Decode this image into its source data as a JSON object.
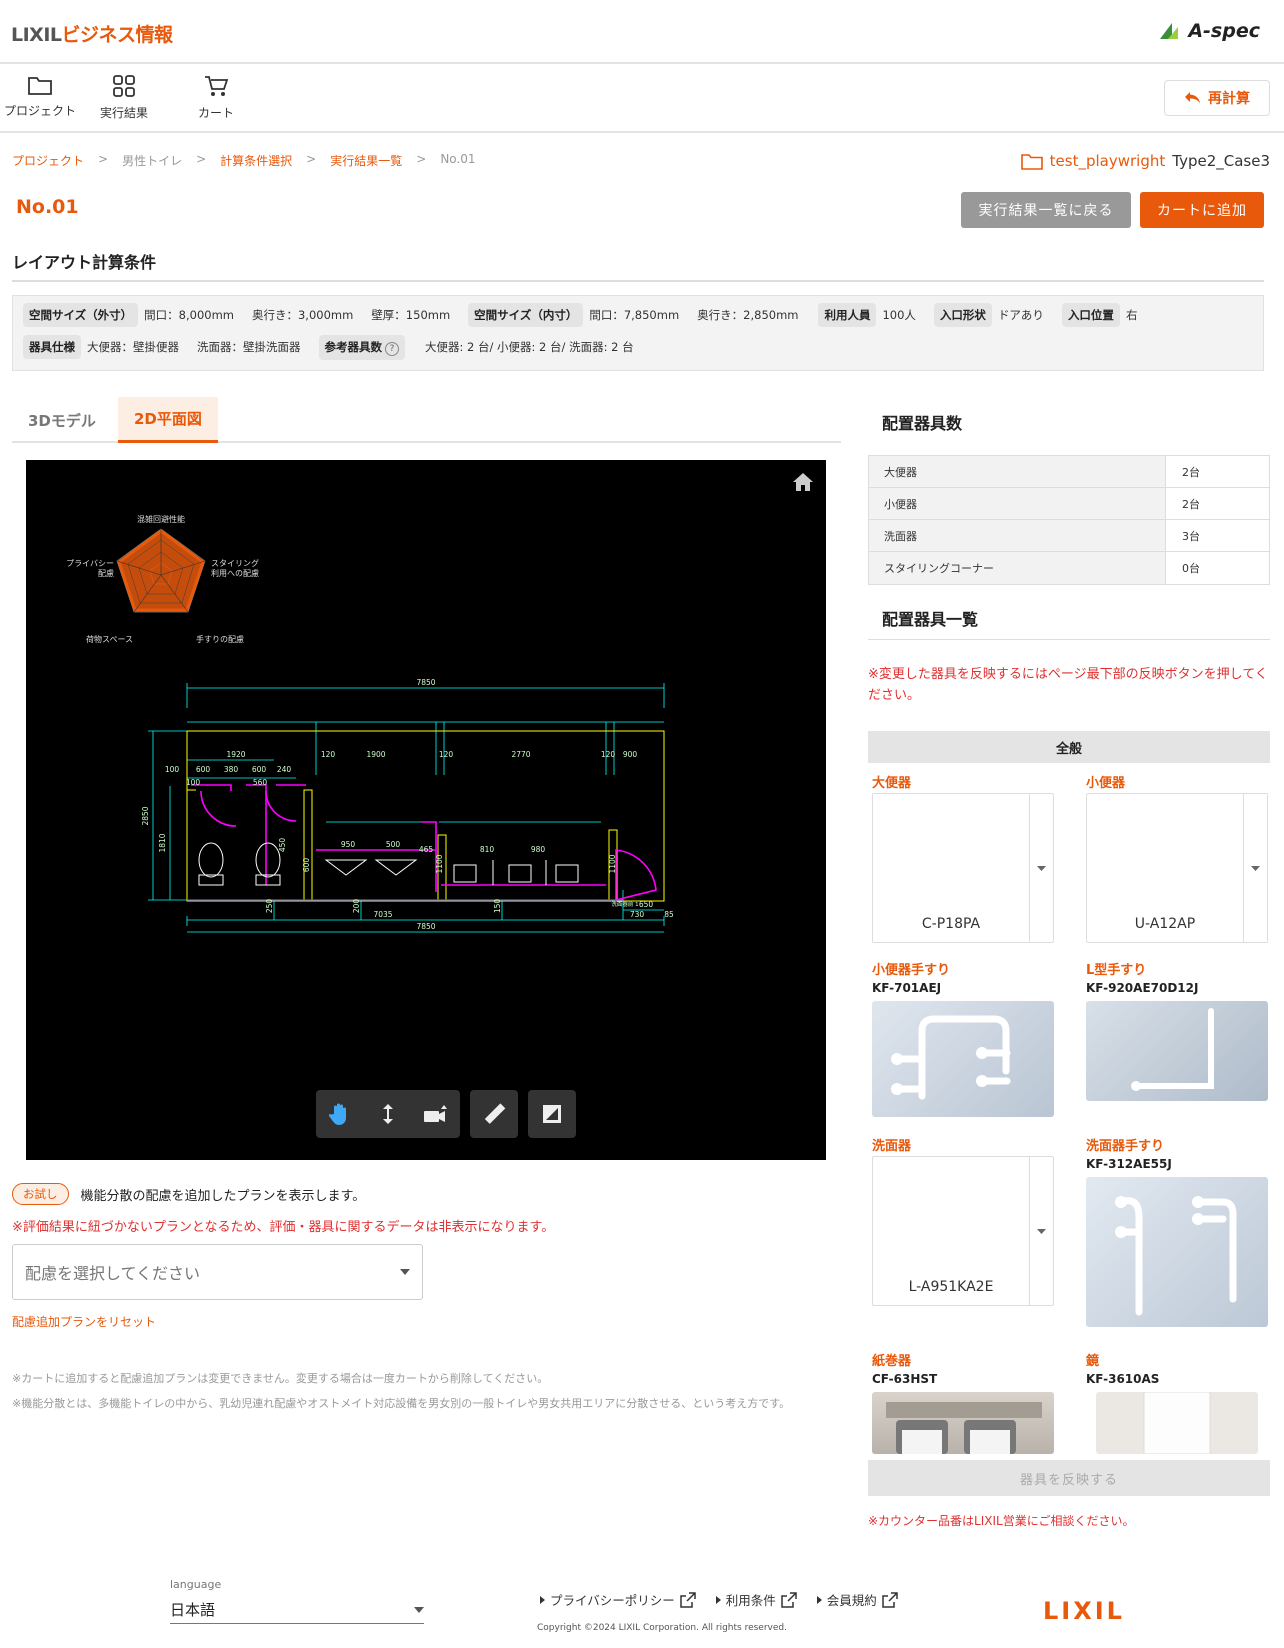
{
  "header": {
    "brand_main": "LIXIL",
    "brand_sub": "ビジネス情報",
    "aspec": "A-spec"
  },
  "toolbar": {
    "project": "プロジェクト",
    "results": "実行結果",
    "cart": "カート",
    "recalc": "再計算"
  },
  "breadcrumb": [
    "プロジェクト",
    ">",
    "男性トイレ",
    ">",
    "計算条件選択",
    ">",
    "実行結果一覧",
    ">",
    "No.01"
  ],
  "project": {
    "name": "test_playwright",
    "case": "Type2_Case3"
  },
  "page": {
    "title": "No.01",
    "back": "実行結果一覧に戻る",
    "add_cart": "カートに追加",
    "section": "レイアウト計算条件"
  },
  "conditions": {
    "outer_tag": "空間サイズ（外寸）",
    "outer_w": "間口：8,000mm",
    "outer_d": "奥行き：3,000mm",
    "wall": "壁厚：150mm",
    "inner_tag": "空間サイズ（内寸）",
    "inner_w": "間口：7,850mm",
    "inner_d": "奥行き：2,850mm",
    "users_tag": "利用人員",
    "users": "100人",
    "entry_tag": "入口形状",
    "entry": "ドアあり",
    "pos_tag": "入口位置",
    "pos": "右",
    "fix_tag": "器具仕様",
    "fix1": "大便器：壁掛便器",
    "fix2": "洗面器：壁掛洗面器",
    "ref_tag": "参考器具数",
    "q": "?",
    "ref": "大便器: 2 台/ 小便器: 2 台/ 洗面器: 2 台"
  },
  "tabs": {
    "t3d": "3Dモデル",
    "t2d": "2D平面図"
  },
  "radar": {
    "top": "混雑回避性能",
    "right1": "スタイリング",
    "right2": "利用への配慮",
    "br": "手すりの配慮",
    "bl": "荷物スペース",
    "left1": "プライバシー",
    "left2": "配慮"
  },
  "cad_dims": {
    "d7850": "7850",
    "d1920": "1920",
    "d120a": "120",
    "d1900": "1900",
    "d120b": "120",
    "d2770": "2770",
    "d120c": "120",
    "d900": "900",
    "d100": "100",
    "d600": "600",
    "d380": "380",
    "d600b": "600",
    "d240": "240",
    "d560": "560",
    "d100b": "100",
    "d2850": "2850",
    "d1810": "1810",
    "d950": "950",
    "d500": "500",
    "d465": "465",
    "d810": "810",
    "d980": "980",
    "d1100": "1100",
    "d1100b": "1100",
    "d600v": "600",
    "d450": "450",
    "d250": "250",
    "d200": "200",
    "d150": "150",
    "d7035": "7035",
    "d650": "650",
    "d730": "730",
    "d85": "85",
    "d7850b": "7850",
    "dlbl": "洗面器前 1"
  },
  "trial": {
    "badge": "お試し",
    "text": "機能分散の配慮を追加したプランを表示します。"
  },
  "warn": "※評価結果に紐づかないプランとなるため、評価・器具に関するデータは非表示になります。",
  "select": {
    "placeholder": "配慮を選択してください"
  },
  "reset": "配慮追加プランをリセット",
  "notes": {
    "n1": "※カートに追加すると配慮追加プランは変更できません。変更する場合は一度カートから削除してください。",
    "n2": "※機能分散とは、多機能トイレの中から、乳幼児連れ配慮やオストメイト対応設備を男女別の一般トイレや男女共用エリアに分散させる、という考え方です。"
  },
  "counts": {
    "title": "配置器具数",
    "rows": [
      [
        "大便器",
        "2台"
      ],
      [
        "小便器",
        "2台"
      ],
      [
        "洗面器",
        "3台"
      ],
      [
        "スタイリングコーナー",
        "0台"
      ]
    ]
  },
  "list": {
    "title": "配置器具一覧",
    "warn": "※変更した器具を反映するにはページ最下部の反映ボタンを押してください。",
    "general": "全般",
    "toilet": "大便器",
    "toilet_val": "C-P18PA",
    "urinal": "小便器",
    "urinal_val": "U-A12AP",
    "urinal_rail": "小便器手すり",
    "urinal_rail_code": "KF-701AEJ",
    "lrail": "L型手すり",
    "lrail_code": "KF-920AE70D12J",
    "basin": "洗面器",
    "basin_val": "L-A951KA2E",
    "basin_rail": "洗面器手すり",
    "basin_rail_code": "KF-312AE55J",
    "paper": "紙巻器",
    "paper_code": "CF-63HST",
    "mirror": "鏡",
    "mirror_code": "KF-3610AS",
    "apply": "器具を反映する",
    "note": "※カウンター品番はLIXIL営業にご相談ください。"
  },
  "footer": {
    "lang_label": "language",
    "lang": "日本語",
    "privacy": "プライバシーポリシー",
    "terms": "利用条件",
    "member": "会員規約",
    "copyright": "Copyright ©2024 LIXIL Corporation. All rights reserved.",
    "logo": "LIXIL"
  },
  "colors": {
    "accent": "#e8590c",
    "error": "#e03030"
  }
}
